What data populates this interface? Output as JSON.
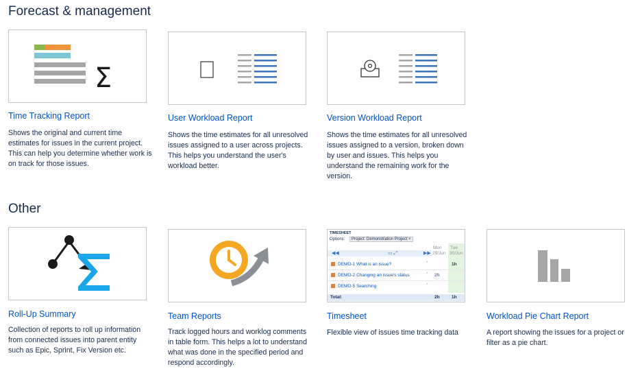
{
  "sections": {
    "forecast": {
      "title": "Forecast & management",
      "cards": [
        {
          "title": "Time Tracking Report",
          "icon": "time-tracking-icon",
          "description": "Shows the original and current time estimates for issues in the current project. This can help you determine whether work is on track for those issues."
        },
        {
          "title": "User Workload Report",
          "icon": "user-workload-icon",
          "description": "Shows the time estimates for all unresolved issues assigned to a user across projects. This helps you understand the user's workload better."
        },
        {
          "title": "Version Workload Report",
          "icon": "version-workload-icon",
          "description": "Shows the time estimates for all unresolved issues assigned to a version, broken down by user and issues. This helps you understand the remaining work for the version."
        }
      ]
    },
    "other": {
      "title": "Other",
      "cards": [
        {
          "title": "Roll-Up Summary",
          "icon": "rollup-summary-icon",
          "description": "Collection of reports to roll up information from connected issues into parent entity such as Epic, Sprint, Fix Version etc."
        },
        {
          "title": "Team Reports",
          "icon": "team-reports-icon",
          "description": "Track logged hours and worklog comments in table form. This helps a lot to understand what was done in the specified period and respond accordingly."
        },
        {
          "title": "Timesheet",
          "icon": "timesheet-preview",
          "description": "Flexible view of issues time tracking data"
        },
        {
          "title": "Workload Pie Chart Report",
          "icon": "bar-chart-icon",
          "description": "A report showing the issues for a project or filter as a pie chart."
        }
      ]
    }
  },
  "timesheet_preview": {
    "heading": "TIMESHEET",
    "options_label": "Options:",
    "project_chip": "Project: Demonstration Project ×",
    "col_mon": "Mon",
    "col_mon_date": "29/Jun",
    "col_tue": "Tue",
    "col_tue_date": "30/Jun",
    "rows": [
      {
        "issue": "DEMO-1 What is an issue?",
        "mon": "",
        "tue": "1h"
      },
      {
        "issue": "DEMO-2 Changing an issue's status",
        "mon": "2h",
        "tue": ""
      },
      {
        "issue": "DEMO-5 Searching",
        "mon": "",
        "tue": ""
      }
    ],
    "total_label": "Total:",
    "total_mon": "2h",
    "total_tue": "1h"
  },
  "colors": {
    "link": "#0052cc",
    "rollup_blue": "#1aa6e8",
    "team_orange": "#f5a623",
    "version_blue": "#3b73b9",
    "gray_bar": "#a6a6a6"
  }
}
